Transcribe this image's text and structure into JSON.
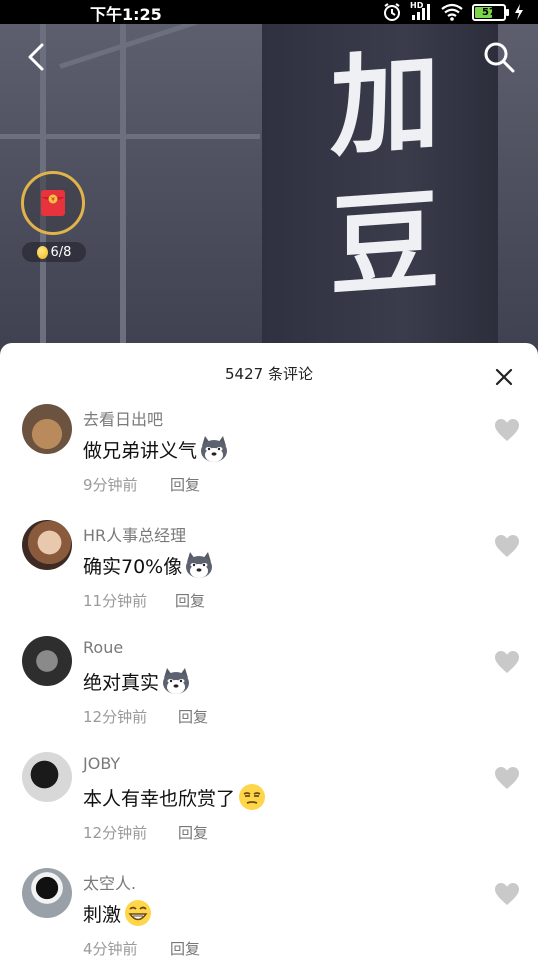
{
  "status_bar": {
    "time": "下午1:25",
    "hd_label": "HD",
    "battery_level": "57",
    "icons": [
      "alarm-icon",
      "signal-icon",
      "wifi-icon",
      "battery-icon",
      "charging-icon"
    ]
  },
  "video": {
    "banner_text": "加豆",
    "reward": {
      "progress": "6/8",
      "icon": "red-packet-icon"
    }
  },
  "comments_panel": {
    "title": "5427 条评论",
    "reply_label": "回复",
    "comments": [
      {
        "user": "去看日出吧",
        "text": "做兄弟讲义气",
        "time": "9分钟前",
        "emoji": "husky-emoji"
      },
      {
        "user": "HR人事总经理",
        "text": "确实70%像",
        "time": "11分钟前",
        "emoji": "husky-emoji"
      },
      {
        "user": "Roue",
        "text": "绝对真实",
        "time": "12分钟前",
        "emoji": "husky-emoji"
      },
      {
        "user": "JOBY",
        "text": "本人有幸也欣赏了",
        "time": "12分钟前",
        "emoji": "smug-face-emoji"
      },
      {
        "user": "太空人.",
        "text": "刺激",
        "time": "4分钟前",
        "emoji": "grin-emoji"
      }
    ]
  },
  "colors": {
    "accent_gold": "#e0b44a",
    "battery_green": "#7bd64c",
    "red_packet": "#e8333c"
  }
}
